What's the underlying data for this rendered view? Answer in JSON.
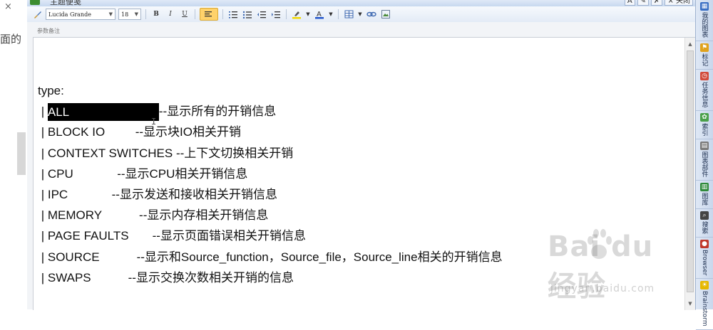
{
  "left_edge": {
    "text": "面的",
    "close_glyph": "×"
  },
  "window": {
    "title": "主题便笺",
    "buttons": [
      "A",
      "✎",
      "✗",
      "× 关闭"
    ]
  },
  "toolbar": {
    "font_family": "Lucida Grande",
    "font_size": "18",
    "bold": "B",
    "italic": "I",
    "underline": "U"
  },
  "editor": {
    "label": "参数备注",
    "heading": "type:",
    "lines": [
      {
        "pipe": " | ",
        "option": "ALL",
        "gap": "",
        "desc": "--显示所有的开销信息",
        "selected": true
      },
      {
        "pipe": " | ",
        "option": "BLOCK IO",
        "gap": "         ",
        "desc": "--显示块IO相关开销"
      },
      {
        "pipe": " | ",
        "option": "CONTEXT SWITCHES",
        "gap": " ",
        "desc": "--上下文切换相关开销"
      },
      {
        "pipe": " | ",
        "option": "CPU",
        "gap": "             ",
        "desc": "--显示CPU相关开销信息"
      },
      {
        "pipe": " | ",
        "option": "IPC",
        "gap": "             ",
        "desc": "--显示发送和接收相关开销信息"
      },
      {
        "pipe": " | ",
        "option": "MEMORY",
        "gap": "           ",
        "desc": "--显示内存相关开销信息"
      },
      {
        "pipe": " | ",
        "option": "PAGE FAULTS",
        "gap": "       ",
        "desc": "--显示页面错误相关开销信息"
      },
      {
        "pipe": " | ",
        "option": "SOURCE",
        "gap": "           ",
        "desc": "--显示和Source_function，Source_file，Source_line相关的开销信息"
      },
      {
        "pipe": " | ",
        "option": "SWAPS",
        "gap": "           ",
        "desc": "--显示交换次数相关开销的信息"
      }
    ]
  },
  "sidebar": {
    "items": [
      {
        "label": "我的图表",
        "icon": "chart-icon",
        "color": "#3a6fc4"
      },
      {
        "label": "标记",
        "icon": "flag-icon",
        "color": "#e0a21c"
      },
      {
        "label": "任务信息",
        "icon": "clock-icon",
        "color": "#d24b3b"
      },
      {
        "label": "索引",
        "icon": "palette-icon",
        "color": "#4aa04a"
      },
      {
        "label": "图表部件",
        "icon": "parts-icon",
        "color": "#7a7a7a"
      },
      {
        "label": "图库",
        "icon": "library-icon",
        "color": "#2f8a3a"
      },
      {
        "label": "搜索",
        "icon": "binoculars-icon",
        "color": "#444444"
      },
      {
        "label": "Browser",
        "icon": "browser-icon",
        "color": "#c0392b"
      },
      {
        "label": "Brainstorm",
        "icon": "bulb-icon",
        "color": "#e6b800"
      }
    ]
  },
  "watermark": {
    "logo": "Bai du 经验",
    "url": "jingyan.baidu.com"
  }
}
